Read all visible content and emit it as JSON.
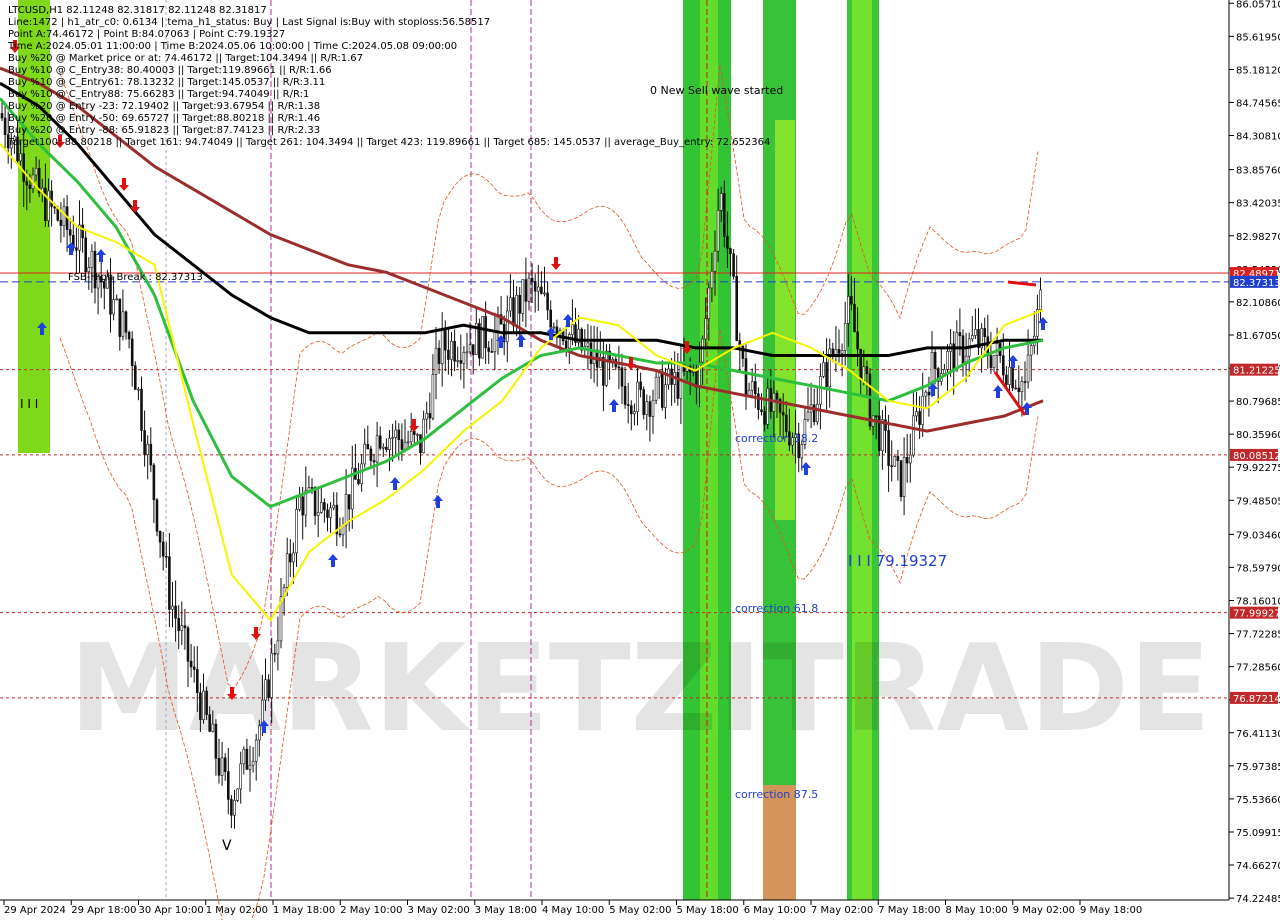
{
  "header": {
    "lines": [
      "LTCUSD,H1  82.11248 82.31817 82.11248 82.31817",
      "Line:1472  |  h1_atr_c0: 0.6134  |  tema_h1_status: Buy  |  Last Signal is:Buy with stoploss:56.58517",
      "Point A:74.46172  |  Point B:84.07063  |  Point C:79.19327",
      "Time A:2024.05.01 11:00:00  |  Time B:2024.05.06 10:00:00  |  Time C:2024.05.08 09:00:00",
      "Buy %20 @ Market price or at: 74.46172  ||  Target:104.3494  ||  R/R:1.67",
      "Buy %10 @ C_Entry38: 80.40003  ||  Target:119.89661  ||  R/R:1.66",
      "Buy %10 @ C_Entry61: 78.13232  ||  Target:145.0537  ||  R/R:3.11",
      "Buy %10 @ C_Entry88: 75.66283  ||  Target:94.74049  ||  R/R:1",
      "Buy %20 @ Entry -23: 72.19402  ||  Target:93.67954  ||  R/R:1.38",
      "Buy %20 @ Entry -50: 69.65727  ||  Target:88.80218  ||  R/R:1.46",
      "Buy %20 @ Entry -88: 65.91823  ||  Target:87.74123  ||  R/R:2.33",
      "Target100: 88.80218  ||  Target 161: 94.74049  ||  Target 261: 104.3494  ||  Target 423: 119.89661  ||  Target 685: 145.0537  ||  average_Buy_entry: 72.652364"
    ]
  },
  "watermark": "MARKETZITRADE",
  "annotations": {
    "sell_wave": "0 New Sell wave started",
    "fsb_label": "FSB-High Break : 82.37313",
    "point_c_label": "I I I 79.19327",
    "corr_38": "correction 38.2",
    "corr_61": "correction 61.8",
    "corr_87": "correction 87.5",
    "bars_mark": "I I I",
    "bottom_mark": "V"
  },
  "colors": {
    "background": "#ffffff",
    "bull_candle": "#111111",
    "bear_candle": "#111111",
    "ema_fast": "#f5f500",
    "ema_mid": "#2fbf3f",
    "ema_slow": "#000000",
    "ema_long": "#9b2d2d",
    "green_zone": "#33cc33",
    "light_green_zone": "#8ef01e",
    "orange_zone": "#d4955a",
    "envelope": "#e8501a",
    "level_line": "#c0282a",
    "blue_level": "#1f3fd0",
    "vertical_magenta": "#b0309a",
    "vertical_grey": "#99aacc",
    "buy_arrow": "#1f3fe0",
    "sell_arrow": "#e01010"
  },
  "chart_data": {
    "type": "candlestick",
    "symbol": "LTCUSD",
    "timeframe": "H1",
    "ohlc_last": {
      "open": 82.11248,
      "high": 82.31817,
      "low": 82.11248,
      "close": 82.31817
    },
    "ylim": [
      74.2,
      86.1
    ],
    "y_ticks": [
      "86.05710",
      "85.61950",
      "85.18120",
      "84.74565",
      "84.30810",
      "83.85760",
      "83.42035",
      "82.98270",
      "82.54520",
      "82.10860",
      "81.67050",
      "81.23300",
      "80.79685",
      "80.35960",
      "79.92275",
      "79.48505",
      "79.03460",
      "78.59790",
      "78.16010",
      "77.72285",
      "77.28560",
      "76.84880",
      "76.41130",
      "75.97385",
      "75.53660",
      "75.09915",
      "74.66270",
      "74.22485"
    ],
    "x_ticks": [
      "29 Apr 2024",
      "29 Apr 18:00",
      "30 Apr 10:00",
      "1 May 02:00",
      "1 May 18:00",
      "2 May 10:00",
      "3 May 02:00",
      "3 May 18:00",
      "4 May 10:00",
      "5 May 02:00",
      "5 May 18:00",
      "6 May 10:00",
      "7 May 02:00",
      "7 May 18:00",
      "8 May 10:00",
      "9 May 02:00",
      "9 May 18:00"
    ],
    "levels": [
      {
        "label": "82.48971",
        "value": 82.48971,
        "color": "#e02020",
        "style": "solid"
      },
      {
        "label": "82.37313",
        "value": 82.37313,
        "color": "#1f3fd0",
        "style": "dashed"
      },
      {
        "label": "81.21225",
        "value": 81.21225,
        "color": "#c0282a",
        "style": "dotted"
      },
      {
        "label": "80.08512",
        "value": 80.08512,
        "color": "#c0282a",
        "style": "dotted"
      },
      {
        "label": "77.99927",
        "value": 77.99927,
        "color": "#c0282a",
        "style": "dotted"
      },
      {
        "label": "76.87214",
        "value": 76.87214,
        "color": "#c0282a",
        "style": "dotted"
      }
    ],
    "points": {
      "A": 74.46172,
      "B": 84.07063,
      "C": 79.19327
    },
    "ema_fast": [
      84.2,
      83.6,
      83.1,
      82.9,
      82.6,
      80.5,
      78.5,
      77.9,
      78.8,
      79.2,
      79.5,
      79.9,
      80.4,
      80.8,
      81.5,
      81.9,
      81.8,
      81.4,
      81.2,
      81.5,
      81.7,
      81.5,
      81.2,
      80.8,
      80.7,
      81.1,
      81.8,
      82.0
    ],
    "ema_mid": [
      84.8,
      84.2,
      83.7,
      83.1,
      82.2,
      80.8,
      79.8,
      79.4,
      79.6,
      79.8,
      80.0,
      80.3,
      80.7,
      81.1,
      81.4,
      81.5,
      81.4,
      81.3,
      81.3,
      81.2,
      81.1,
      81.0,
      80.9,
      80.8,
      81.0,
      81.3,
      81.5,
      81.6
    ],
    "ema_slow": [
      85.0,
      84.7,
      84.2,
      83.6,
      83.0,
      82.6,
      82.2,
      81.9,
      81.7,
      81.7,
      81.7,
      81.7,
      81.8,
      81.7,
      81.7,
      81.6,
      81.6,
      81.6,
      81.5,
      81.5,
      81.4,
      81.4,
      81.4,
      81.4,
      81.5,
      81.5,
      81.6,
      81.6
    ],
    "ema_long": [
      85.2,
      85.0,
      84.7,
      84.3,
      83.9,
      83.6,
      83.3,
      83.0,
      82.8,
      82.6,
      82.5,
      82.3,
      82.1,
      81.9,
      81.6,
      81.4,
      81.3,
      81.2,
      81.0,
      80.9,
      80.8,
      80.7,
      80.6,
      80.5,
      80.4,
      80.5,
      80.6,
      80.8
    ]
  }
}
